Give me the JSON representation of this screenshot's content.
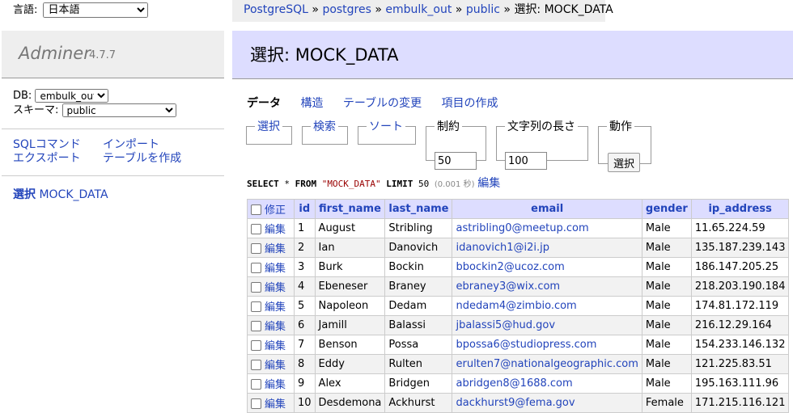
{
  "menu": {
    "lang_label": "言語:",
    "lang_value": "日本語",
    "logo": "Adminer",
    "version": "4.7.7",
    "db_label": "DB:",
    "db_value": "embulk_out",
    "schema_label": "スキーマ:",
    "schema_value": "public",
    "links": [
      "SQLコマンド",
      "インポート",
      "エクスポート",
      "テーブルを作成"
    ],
    "table_prefix": "選択",
    "table_name": "MOCK_DATA"
  },
  "breadcrumb": {
    "items": [
      "PostgreSQL",
      "postgres",
      "embulk_out",
      "public"
    ],
    "sep": "»",
    "current": "選択: MOCK_DATA"
  },
  "title": "選択: MOCK_DATA",
  "tabs": [
    "データ",
    "構造",
    "テーブルの変更",
    "項目の作成"
  ],
  "filters": {
    "select": "選択",
    "search": "検索",
    "sort": "ソート",
    "limit_label": "制約",
    "limit_value": "50",
    "textlen_label": "文字列の長さ",
    "textlen_value": "100",
    "action_label": "動作",
    "action_button": "選択"
  },
  "sql": {
    "select": "SELECT",
    "star": "*",
    "from": "FROM",
    "table": "\"MOCK_DATA\"",
    "limit": "LIMIT",
    "limit_n": "50",
    "time": "(0.001 秒)",
    "edit": "編集"
  },
  "table": {
    "edit_header": "修正",
    "headers": [
      "id",
      "first_name",
      "last_name",
      "email",
      "gender",
      "ip_address"
    ],
    "edit_label": "編集",
    "rows": [
      [
        "1",
        "August",
        "Stribling",
        "astribling0@meetup.com",
        "Male",
        "11.65.224.59"
      ],
      [
        "2",
        "Ian",
        "Danovich",
        "idanovich1@i2i.jp",
        "Male",
        "135.187.239.143"
      ],
      [
        "3",
        "Burk",
        "Bockin",
        "bbockin2@ucoz.com",
        "Male",
        "186.147.205.25"
      ],
      [
        "4",
        "Ebeneser",
        "Braney",
        "ebraney3@wix.com",
        "Male",
        "218.203.190.184"
      ],
      [
        "5",
        "Napoleon",
        "Dedam",
        "ndedam4@zimbio.com",
        "Male",
        "174.81.172.119"
      ],
      [
        "6",
        "Jamill",
        "Balassi",
        "jbalassi5@hud.gov",
        "Male",
        "216.12.29.164"
      ],
      [
        "7",
        "Benson",
        "Possa",
        "bpossa6@studiopress.com",
        "Male",
        "154.233.146.132"
      ],
      [
        "8",
        "Eddy",
        "Rulten",
        "erulten7@nationalgeographic.com",
        "Male",
        "121.225.83.51"
      ],
      [
        "9",
        "Alex",
        "Bridgen",
        "abridgen8@1688.com",
        "Male",
        "195.163.111.96"
      ],
      [
        "10",
        "Desdemona",
        "Ackhurst",
        "dackhurst9@fema.gov",
        "Female",
        "171.215.116.121"
      ]
    ]
  }
}
